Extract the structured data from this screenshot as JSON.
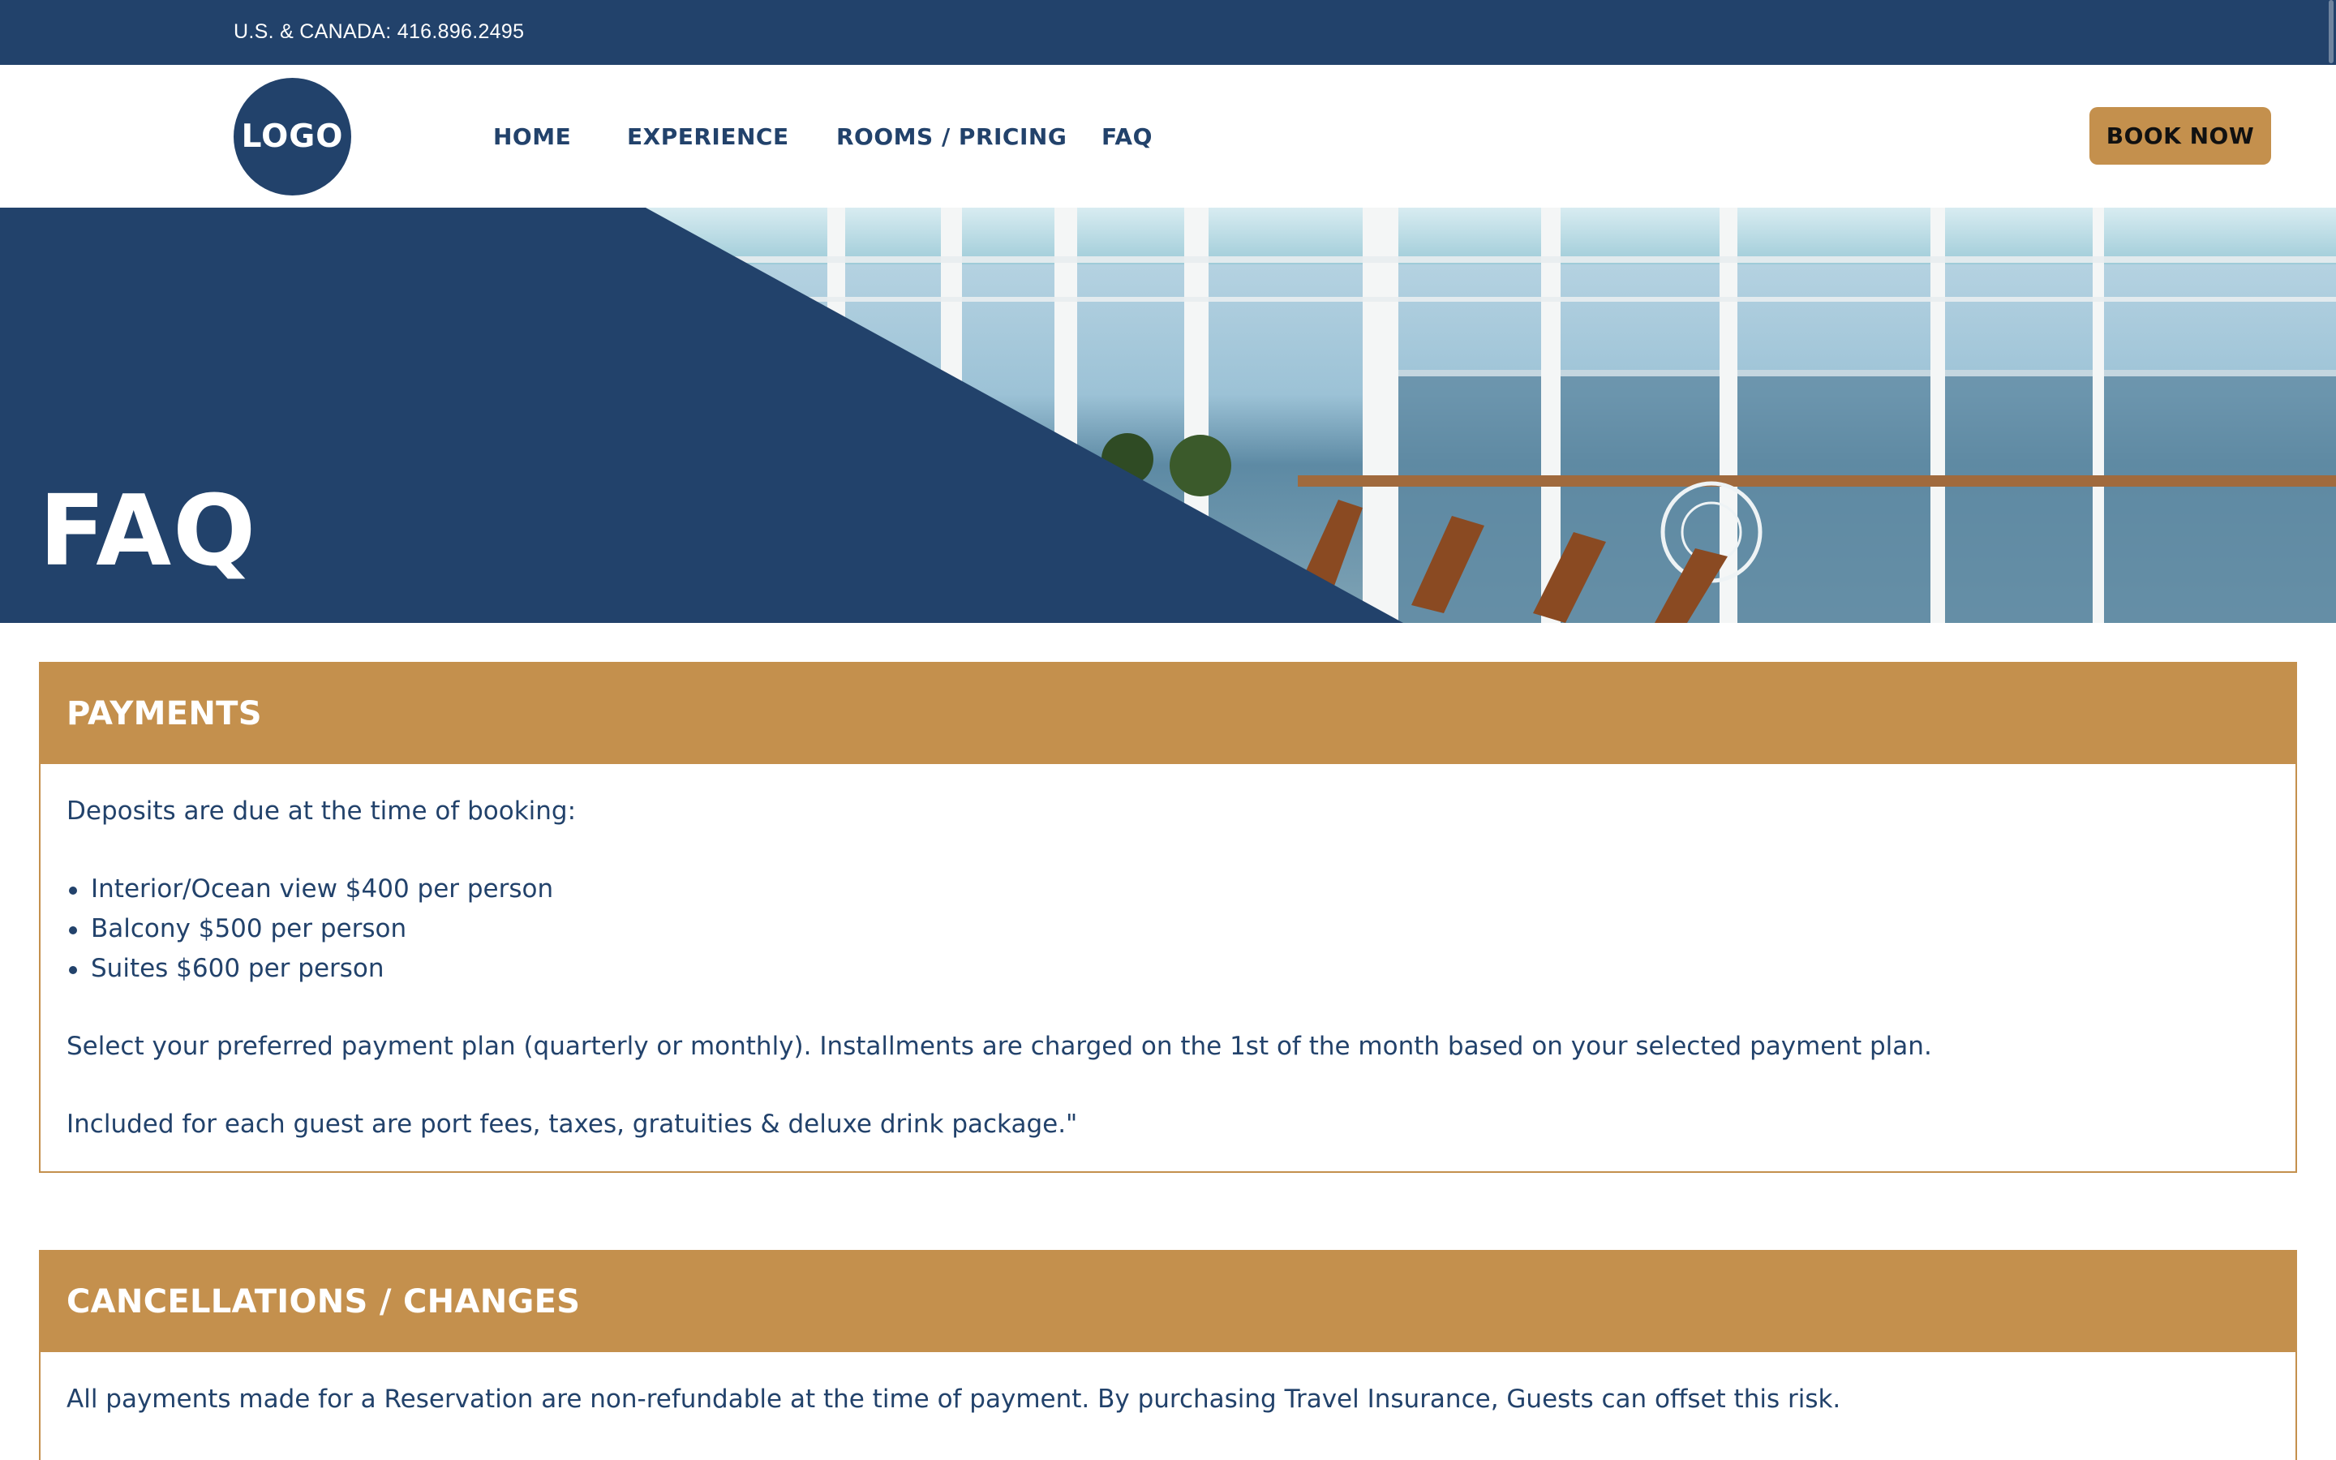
{
  "topbar": {
    "phone": "U.S. & CANADA: 416.896.2495"
  },
  "header": {
    "logo": "LOGO",
    "nav": [
      "HOME",
      "EXPERIENCE",
      "ROOMS / PRICING",
      "FAQ"
    ],
    "cta": "BOOK NOW"
  },
  "hero": {
    "title": "FAQ"
  },
  "sections": [
    {
      "title": "PAYMENTS",
      "intro": "Deposits are due at the time of booking:",
      "bullets": [
        "Interior/Ocean view $400 per person",
        "Balcony $500 per person",
        "Suites $600 per person"
      ],
      "para1": "Select your preferred payment plan (quarterly or monthly). Installments are charged on the 1st of the month based on your selected payment plan.",
      "para2": "Included for each guest are port fees, taxes, gratuities & deluxe drink package.\""
    },
    {
      "title": "CANCELLATIONS / CHANGES",
      "para1": "All payments made for a Reservation are non-refundable at the time of payment. By purchasing Travel Insurance, Guests can offset this risk."
    }
  ],
  "colors": {
    "navy": "#22426b",
    "gold": "#c4904d",
    "white": "#ffffff"
  }
}
